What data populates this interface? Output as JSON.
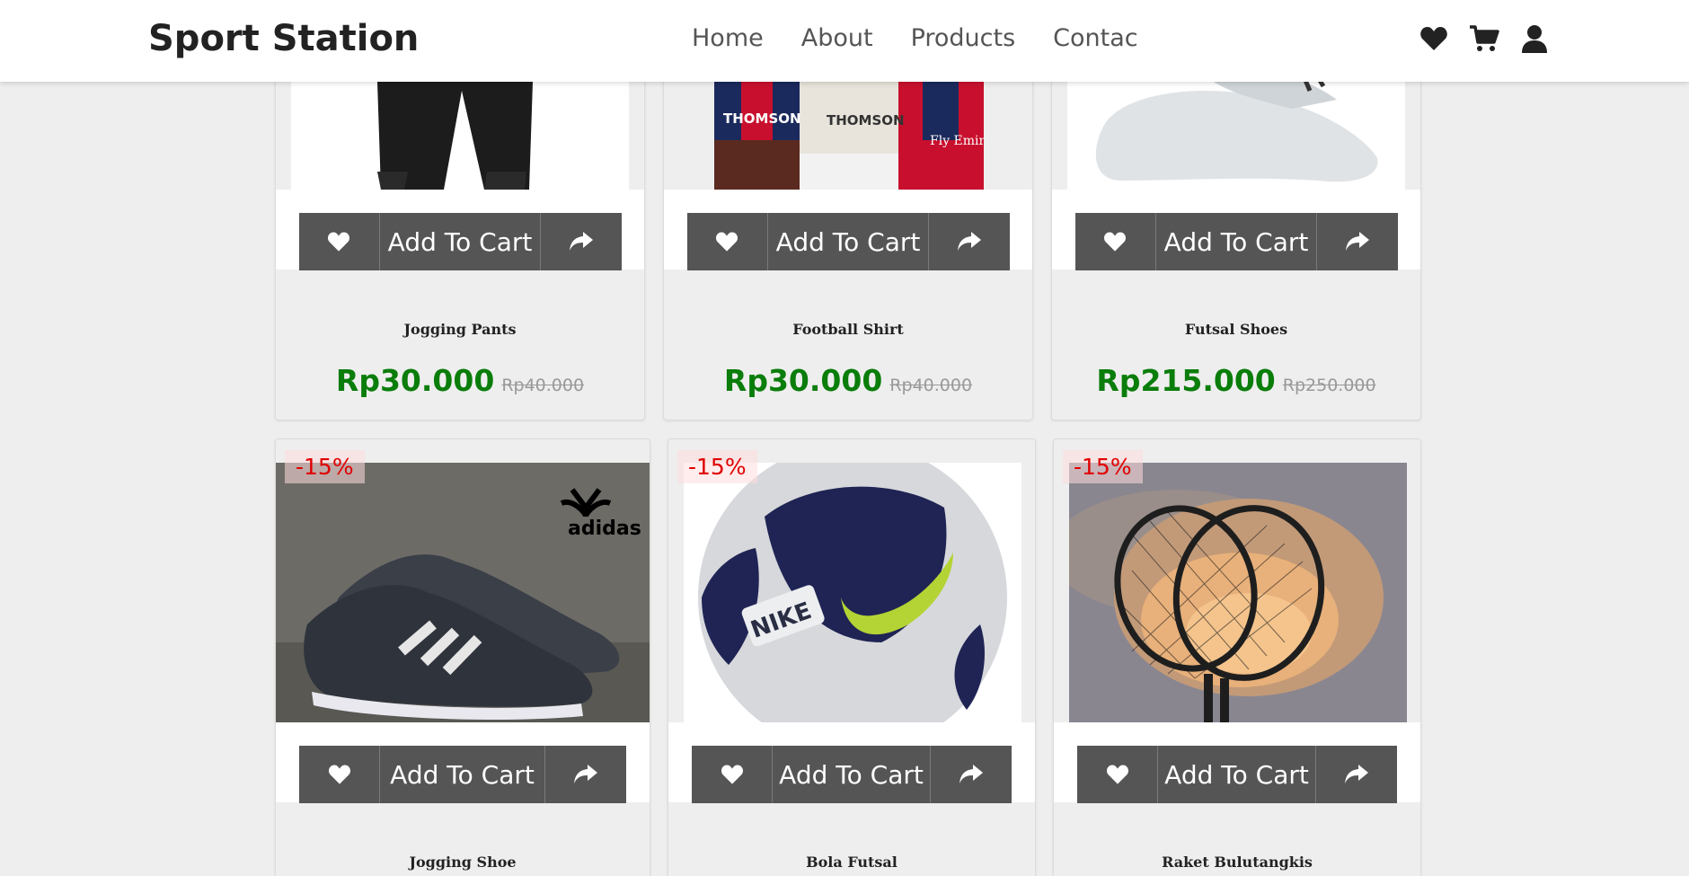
{
  "header": {
    "title": "Sport Station",
    "nav": [
      "Home",
      "About",
      "Products",
      "Contac"
    ],
    "icons": [
      "heart-icon",
      "cart-icon",
      "user-icon"
    ]
  },
  "colors": {
    "price": "#0a7d0a",
    "discount": "#e00000",
    "button": "#555555"
  },
  "buttons": {
    "add_to_cart": "Add To Cart"
  },
  "products_row1": [
    {
      "name": "Jogging Pants",
      "price": "Rp30.000",
      "old_price": "Rp40.000"
    },
    {
      "name": "Football Shirt",
      "price": "Rp30.000",
      "old_price": "Rp40.000"
    },
    {
      "name": "Futsal Shoes",
      "price": "Rp215.000",
      "old_price": "Rp250.000"
    }
  ],
  "products_row2": [
    {
      "name": "Jogging Shoe",
      "discount": "-15%",
      "image_text": "adidas"
    },
    {
      "name": "Bola Futsal",
      "discount": "-15%",
      "image_text": "NIKE"
    },
    {
      "name": "Raket Bulutangkis",
      "discount": "-15%"
    }
  ],
  "row1_image_text": [
    "THOMSON",
    "THOMSON",
    "Fly Emirates"
  ]
}
